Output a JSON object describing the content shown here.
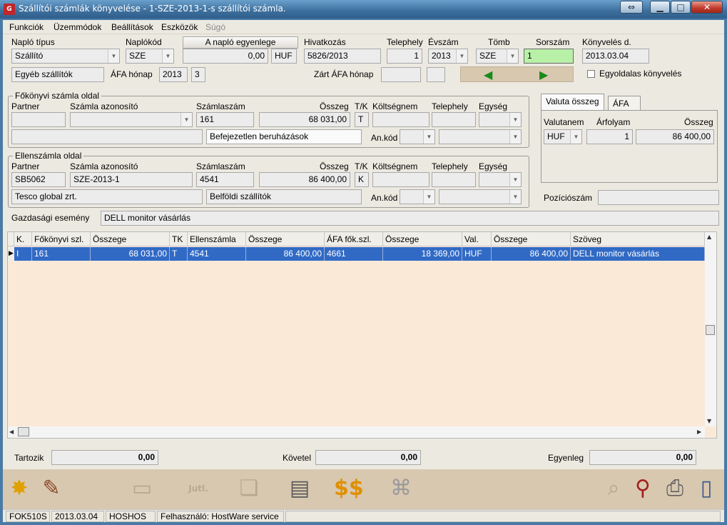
{
  "title": "Szállítói számlák könyvelése - 1-SZE-2013-1-s szállítói számla.",
  "menu": [
    "Funkciók",
    "Üzemmódok",
    "Beállítások",
    "Eszközök",
    "Súgó"
  ],
  "header": {
    "naplo_tipus_label": "Napló típus",
    "naplo_tipus_value": "Szállító",
    "naplokod_label": "Naplókód",
    "naplokod_value": "SZE",
    "egyenleg_button": "A napló egyenlege",
    "egyenleg_value": "0,00",
    "egyenleg_currency": "HUF",
    "hivatkozas_label": "Hivatkozás",
    "hivatkozas_value": "5826/2013",
    "telephely_label": "Telephely",
    "telephely_value": "1",
    "evszam_label": "Évszám",
    "evszam_value": "2013",
    "tomb_label": "Tömb",
    "tomb_value": "SZE",
    "sorszam_label": "Sorszám",
    "sorszam_value": "1",
    "konyveles_label": "Könyvelés d.",
    "konyveles_value": "2013.03.04",
    "egyeb_szallitok": "Egyéb szállítók",
    "afa_honap_label": "ÁFA hónap",
    "afa_honap_year": "2013",
    "afa_honap_month": "3",
    "zart_afa_label": "Zárt ÁFA hónap",
    "egyoldalas_label": "Egyoldalas könyvelés"
  },
  "fokonyvi": {
    "group_title": "Főkönyvi számla oldal",
    "partner_label": "Partner",
    "szamla_azon_label": "Számla azonosító",
    "szamlaszam_label": "Számlaszám",
    "osszeg_label": "Összeg",
    "tk_label": "T/K",
    "koltseg_label": "Költségnem",
    "telephely_label": "Telephely",
    "egyseg_label": "Egység",
    "szamlaszam_value": "161",
    "osszeg_value": "68 031,00",
    "tk_value": "T",
    "szamla_nev": "Befejezetlen beruházások",
    "ankod_label": "An.kód"
  },
  "ellen": {
    "group_title": "Ellenszámla oldal",
    "partner_label": "Partner",
    "szamla_azon_label": "Számla azonosító",
    "szamlaszam_label": "Számlaszám",
    "osszeg_label": "Összeg",
    "tk_label": "T/K",
    "koltseg_label": "Költségnem",
    "telephely_label": "Telephely",
    "egyseg_label": "Egység",
    "partner_value": "SB5062",
    "szamla_azon_value": "SZE-2013-1",
    "szamlaszam_value": "4541",
    "osszeg_value": "86 400,00",
    "tk_value": "K",
    "partner_nev": "Tesco global zrt.",
    "szamla_nev": "Belföldi szállítók",
    "ankod_label": "An.kód"
  },
  "valuta": {
    "tab1": "Valuta összeg",
    "tab2": "ÁFA",
    "valutanem_label": "Valutanem",
    "arfolyam_label": "Árfolyam",
    "osszeg_label": "Összeg",
    "valutanem_value": "HUF",
    "arfolyam_value": "1",
    "osszeg_value": "86 400,00",
    "pozicio_label": "Pozíciószám"
  },
  "gazdasagi_label": "Gazdasági esemény",
  "gazdasagi_value": "DELL monitor vásárlás",
  "grid": {
    "headers": [
      "K.",
      "Főkönyvi szl.",
      "Összege",
      "TK",
      "Ellenszámla",
      "Összege",
      "ÁFA fők.szl.",
      "Összege",
      "Val.",
      "Összege",
      "Szöveg"
    ],
    "row": [
      "I",
      "161",
      "68 031,00",
      "T",
      "4541",
      "86 400,00",
      "4661",
      "18 369,00",
      "HUF",
      "86 400,00",
      "DELL monitor vásárlás"
    ]
  },
  "totals": {
    "tartozik_label": "Tartozik",
    "tartozik_value": "0,00",
    "kovetel_label": "Követel",
    "kovetel_value": "0,00",
    "egyenleg_label": "Egyenleg",
    "egyenleg_value": "0,00"
  },
  "toolbar_text": "Jutl.",
  "status": [
    "FOK510S",
    "2013.03.04",
    "HOSHOS",
    "Felhasználó: HostWare service"
  ],
  "colors": {
    "selection": "#316ac5",
    "grid_bg": "#fbe9d8",
    "sorszam_bg": "#b8f0a8",
    "toolbar_bg": "#d8c8b0"
  }
}
